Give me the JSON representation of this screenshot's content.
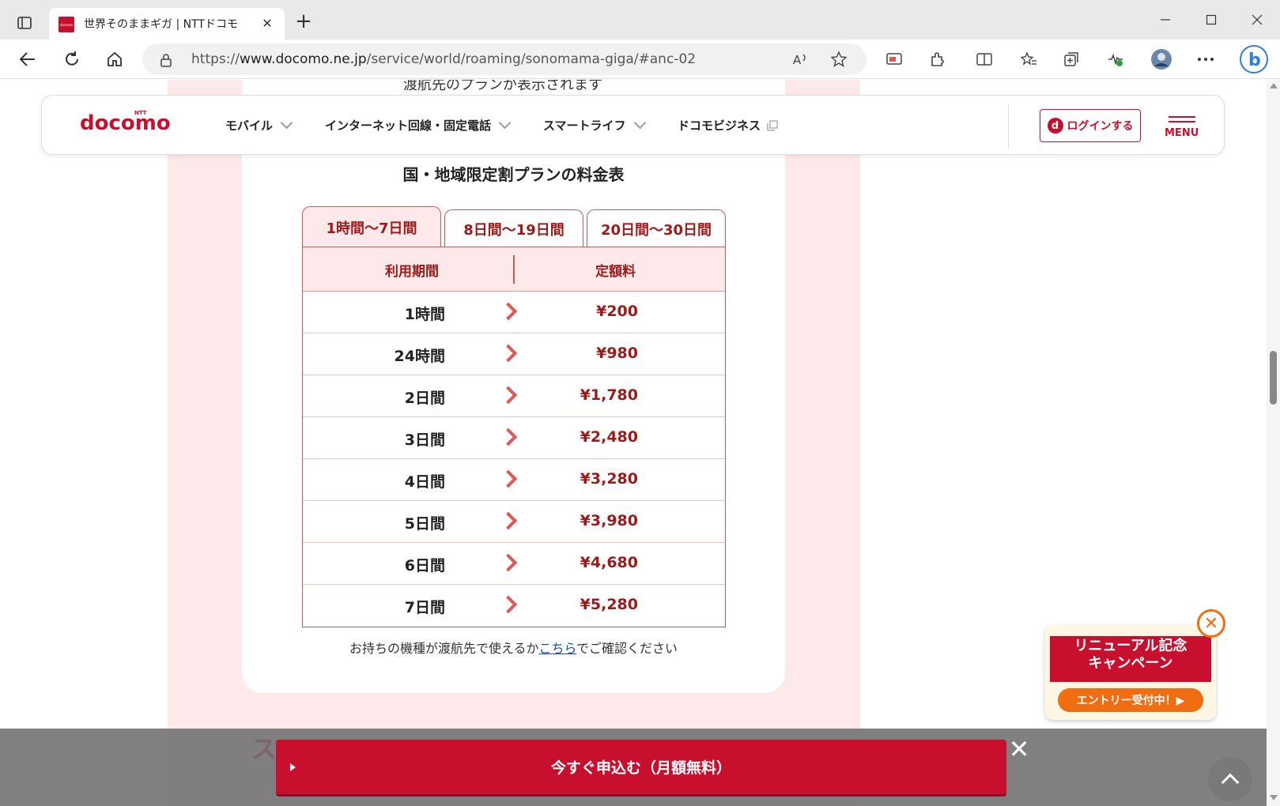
{
  "browser": {
    "tab_title": "世界そのままギガ | NTTドコモ",
    "favicon_text": "docomo",
    "url_prefix": "https://",
    "url_host": "www.docomo.ne.jp",
    "url_path": "/service/world/roaming/sonomama-giga/#anc-02"
  },
  "header": {
    "logo_ntt": "NTT",
    "logo": "docomo",
    "nav": [
      {
        "label": "モバイル"
      },
      {
        "label": "インターネット回線・固定電話"
      },
      {
        "label": "スマートライフ"
      },
      {
        "label": "ドコモビジネス"
      }
    ],
    "login_icon": "d",
    "login_label": "ログインする",
    "menu_label": "MENU"
  },
  "content": {
    "prev_text": "渡航先のプランが表示されます",
    "table_title": "国・地域限定割プランの料金表",
    "tabs": [
      {
        "label": "1時間〜7日間",
        "active": true
      },
      {
        "label": "8日間〜19日間",
        "active": false
      },
      {
        "label": "20日間〜30日間",
        "active": false
      }
    ],
    "table_headers": {
      "period": "利用期間",
      "fee": "定額料"
    },
    "rows": [
      {
        "period": "1時間",
        "price": "¥200"
      },
      {
        "period": "24時間",
        "price": "¥980"
      },
      {
        "period": "2日間",
        "price": "¥1,780"
      },
      {
        "period": "3日間",
        "price": "¥2,480"
      },
      {
        "period": "4日間",
        "price": "¥3,280"
      },
      {
        "period": "5日間",
        "price": "¥3,980"
      },
      {
        "period": "6日間",
        "price": "¥4,680"
      },
      {
        "period": "7日間",
        "price": "¥5,280"
      }
    ],
    "device_note_before": "お持ちの機種が渡航先で使えるか",
    "device_note_link": "こちら",
    "device_note_after": "でご確認ください",
    "peek_heading": "ス"
  },
  "campaign": {
    "title_line1": "リニューアル記念",
    "title_line2": "キャンペーン",
    "entry_label": "エントリー受付中！▶"
  },
  "cta": {
    "label": "今すぐ申込む（月額無料）"
  },
  "colors": {
    "brand": "#c8102e",
    "accent_orange": "#f06d12",
    "panel_pink": "#fde9e9"
  }
}
